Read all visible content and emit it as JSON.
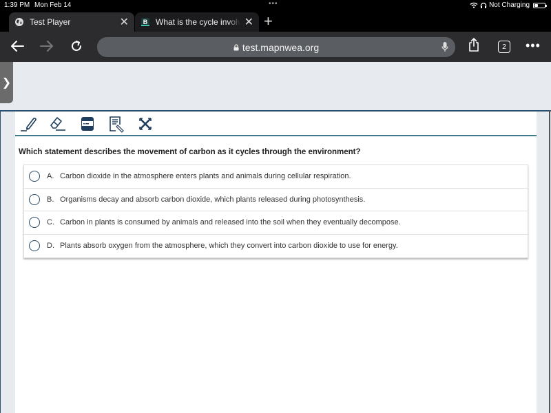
{
  "status_bar": {
    "time": "1:39 PM",
    "date": "Mon Feb 14",
    "multitask_dots": "•••",
    "battery_text": "Not Charging"
  },
  "tabs": [
    {
      "label": "Test Player",
      "icon": "globe-icon",
      "active": true
    },
    {
      "label": "What is the cycle involving",
      "icon": "brainly-icon",
      "active": false
    }
  ],
  "browser": {
    "url": "test.mapnwea.org",
    "tab_count": "2",
    "new_tab": "+",
    "more": "•••"
  },
  "test_tools": [
    {
      "name": "highlighter-tool",
      "icon": "highlighter-icon"
    },
    {
      "name": "eraser-tool",
      "icon": "eraser-icon"
    },
    {
      "name": "line-reader-tool",
      "icon": "line-reader-icon"
    },
    {
      "name": "notepad-tool",
      "icon": "notepad-icon"
    },
    {
      "name": "answer-eliminator-tool",
      "icon": "answer-eliminator-icon"
    }
  ],
  "question": {
    "text": "Which statement describes the movement of carbon as it cycles through the environment?",
    "choices": [
      {
        "letter": "A.",
        "text": "Carbon dioxide in the atmosphere enters plants and animals during cellular respiration.",
        "selected": false
      },
      {
        "letter": "B.",
        "text": "Organisms decay and absorb carbon dioxide, which plants released during photosynthesis.",
        "selected": false
      },
      {
        "letter": "C.",
        "text": "Carbon in plants is consumed by animals and released into the soil when they eventually decompose.",
        "selected": false
      },
      {
        "letter": "D.",
        "text": "Plants absorb oxygen from the atmosphere, which they convert into carbon dioxide to use for energy.",
        "selected": false
      }
    ]
  },
  "colors": {
    "tool_icon": "#1f3d5c",
    "accent_line": "#3f7a8a",
    "radio_border": "#2a4a66"
  }
}
